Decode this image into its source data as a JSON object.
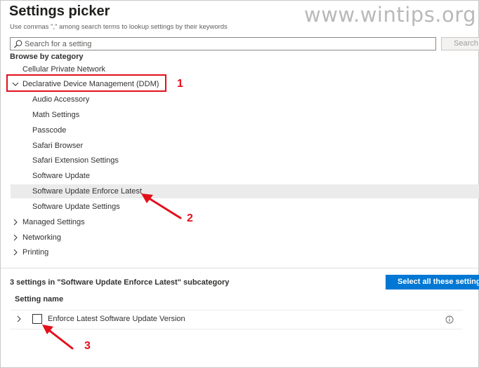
{
  "header": {
    "title": "Settings picker",
    "subtitle": "Use commas \",\" among search terms to lookup settings by their keywords",
    "watermark": "www.wintips.org"
  },
  "search": {
    "placeholder": "Search for a setting",
    "value": "",
    "button_label": "Search"
  },
  "browse": {
    "heading": "Browse by category",
    "items": [
      {
        "label": "Cellular Private Network",
        "level": 0,
        "expander": "none"
      },
      {
        "label": "Declarative Device Management (DDM)",
        "level": 0,
        "expander": "expanded"
      },
      {
        "label": "Audio Accessory",
        "level": 1
      },
      {
        "label": "Math Settings",
        "level": 1
      },
      {
        "label": "Passcode",
        "level": 1
      },
      {
        "label": "Safari Browser",
        "level": 1
      },
      {
        "label": "Safari Extension Settings",
        "level": 1
      },
      {
        "label": "Software Update",
        "level": 1
      },
      {
        "label": "Software Update Enforce Latest",
        "level": 1,
        "selected": true
      },
      {
        "label": "Software Update Settings",
        "level": 1
      },
      {
        "label": "Managed Settings",
        "level": 0,
        "expander": "collapsed"
      },
      {
        "label": "Networking",
        "level": 0,
        "expander": "collapsed"
      },
      {
        "label": "Printing",
        "level": 0,
        "expander": "collapsed"
      }
    ]
  },
  "annotations": {
    "step1": "1",
    "step2": "2",
    "step3": "3",
    "color": "#e3101c"
  },
  "results": {
    "count_text": "3 settings in \"Software Update Enforce Latest\" subcategory",
    "select_all_label": "Select all these settings",
    "column_header": "Setting name",
    "rows": [
      {
        "label": "Enforce Latest Software Update Version",
        "checked": false
      }
    ]
  },
  "colors": {
    "accent": "#0078d4",
    "selected_row": "#ebebeb",
    "annotation": "#e3101c"
  },
  "icons": {
    "search": "search-icon",
    "expand": "chevron-right-icon",
    "collapse": "chevron-down-icon",
    "info": "info-icon"
  }
}
